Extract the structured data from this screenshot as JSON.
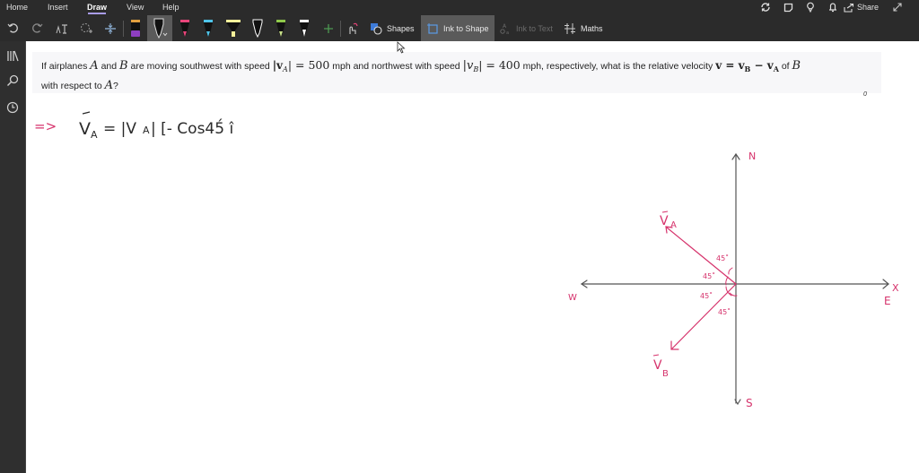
{
  "menu": {
    "tabs": [
      {
        "label": "Home",
        "active": false
      },
      {
        "label": "Insert",
        "active": false
      },
      {
        "label": "Draw",
        "active": true
      },
      {
        "label": "View",
        "active": false
      },
      {
        "label": "Help",
        "active": false
      }
    ],
    "share_label": "Share",
    "right_icons": [
      "sync-icon",
      "sticky-note-icon",
      "lightbulb-icon",
      "bell-icon",
      "share-icon",
      "expand-icon"
    ]
  },
  "toolbar": {
    "pens": [
      {
        "name": "pen-purple",
        "color": "#8e3fc2",
        "cap": "#e0a040"
      },
      {
        "name": "pen-black-selected",
        "color": "#111111",
        "selected": true
      },
      {
        "name": "pen-pink",
        "color": "#e8457a"
      },
      {
        "name": "pen-cyan",
        "color": "#4fc3e8"
      },
      {
        "name": "highlighter-yellow",
        "color": "#f5f09a"
      },
      {
        "name": "pen-black-outline",
        "color": "#111111"
      },
      {
        "name": "pen-green",
        "color": "#8fc84a"
      },
      {
        "name": "pen-white",
        "color": "#ffffff"
      }
    ],
    "shapes_label": "Shapes",
    "ink_to_shape_label": "Ink to Shape",
    "ink_to_text_label": "Ink to Text",
    "maths_label": "Maths",
    "accent_color": "#a99ce8"
  },
  "question": {
    "line1": {
      "p1": "If airplanes ",
      "A": "A",
      "p2": " and ",
      "B": "B",
      "p3": " are moving southwest with speed ",
      "vA": "|v",
      "vA_sub": "A",
      "eq1": "| = ",
      "n1": "500",
      "p4": " mph and northwest with speed ",
      "vB": "|v",
      "vB_sub": "B",
      "eq2": "| = ",
      "n2": "400",
      "p5": " mph, respectively, what is the relative velocity ",
      "rel": "v = v",
      "rel_sub1": "B",
      "minus": " − v",
      "rel_sub2": "A",
      "p6": " of ",
      "B2": "B"
    },
    "line2": {
      "p1": "with respect to ",
      "A": "A",
      "p2": "?"
    },
    "small_mark": "0"
  },
  "ink": {
    "arrow": "=>",
    "equation": "Vₐ = |Vₐ| [- Cos45˚ i",
    "eq_parts": {
      "vec": "V",
      "sub": "A",
      "rest": "= |V",
      "rest_sub": "A",
      "tail": "| [- Cos45́ î"
    },
    "diagram": {
      "north": "N",
      "south": "S",
      "east": "E",
      "west": "W",
      "x_axis": "X",
      "vector_a": "V",
      "vector_a_sub": "A",
      "vector_b": "V",
      "vector_b_sub": "B",
      "angles": [
        "45˚",
        "45˚",
        "45˚",
        "45˚"
      ]
    },
    "ink_color": "#d6336c"
  }
}
